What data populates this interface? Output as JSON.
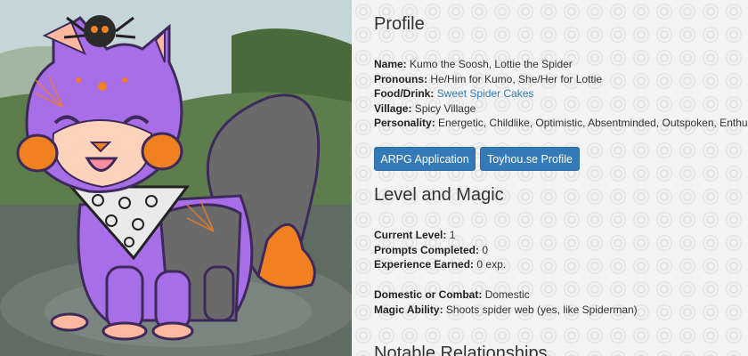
{
  "profile": {
    "heading": "Profile",
    "name_label": "Name:",
    "name_value": " Kumo the Soosh, Lottie the Spider",
    "pronouns_label": "Pronouns:",
    "pronouns_value": " He/Him for Kumo, She/Her for Lottie",
    "food_label": "Food/Drink:",
    "food_link": "Sweet Spider Cakes",
    "village_label": "Village:",
    "village_value": " Spicy Village",
    "personality_label": "Personality:",
    "personality_value": " Energetic, Childlike, Optimistic, Absentminded, Outspoken, Enthus"
  },
  "buttons": {
    "arpg": "ARPG Application",
    "toyhouse": "Toyhou.se Profile"
  },
  "level": {
    "heading": "Level and Magic",
    "current_level_label": "Current Level:",
    "current_level_value": " 1",
    "prompts_label": "Prompts Completed:",
    "prompts_value": " 0",
    "exp_label": "Experience Earned:",
    "exp_value": " 0 exp.",
    "domestic_label": "Domestic or Combat:",
    "domestic_value": " Domestic",
    "magic_label": "Magic Ability:",
    "magic_value": " Shoots spider web (yes, like Spiderman)"
  },
  "notable": {
    "heading": "Notable Relationships"
  },
  "colors": {
    "link": "#337ab7",
    "button": "#337ab7",
    "fur_purple": "#a86ee8",
    "tail_grey": "#6a6a6a",
    "orange": "#f08020"
  }
}
